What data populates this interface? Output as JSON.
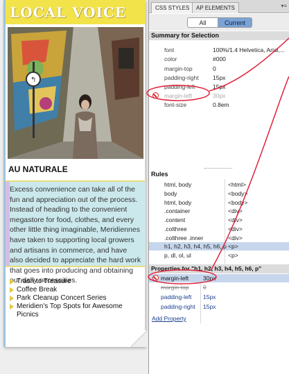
{
  "page_mockup": {
    "logo": "LOCAL VOICE",
    "headline": "AU NATURALE",
    "description": "Excess convenience can take all of the fun and appreciation out of the process. Instead of heading to the convenient megastore for food, clothes, and every other little thing imaginable, Meridiennes have taken to supporting local growers and artisans in commerce, and have also decided to appreciate the hard work that goes into producing and obtaining our daily necessities.",
    "links": [
      "Trash to Treasure",
      "Coffee Break",
      "Park Cleanup Concert Series",
      "Meridien's Top Spots for Awesome Picnics"
    ]
  },
  "panel": {
    "tabs": [
      "CSS STYLES",
      "AP ELEMENTS"
    ],
    "modes": {
      "all": "All",
      "current": "Current"
    },
    "summary_title": "Summary for Selection",
    "summary_rows": [
      {
        "key": "font",
        "value": "100%/1.4 Helvetica, Arial,...",
        "disabled": false
      },
      {
        "key": "color",
        "value": "#000",
        "disabled": false
      },
      {
        "key": "margin-top",
        "value": "0",
        "disabled": false
      },
      {
        "key": "padding-right",
        "value": "15px",
        "disabled": false
      },
      {
        "key": "padding-left",
        "value": "15px",
        "disabled": false
      },
      {
        "key": "margin-left",
        "value": "30px",
        "disabled": true
      },
      {
        "key": "font-size",
        "value": "0.8em",
        "disabled": false
      }
    ],
    "rules_title": "Rules",
    "rules": [
      {
        "selector": "html, body",
        "tag": "<html>",
        "selected": false
      },
      {
        "selector": "body",
        "tag": "<body>",
        "selected": false
      },
      {
        "selector": "html, body",
        "tag": "<body>",
        "selected": false
      },
      {
        "selector": ".container",
        "tag": "<div>",
        "selected": false
      },
      {
        "selector": ".content",
        "tag": "<div>",
        "selected": false
      },
      {
        "selector": ".colthree",
        "tag": "<div>",
        "selected": false
      },
      {
        "selector": ".colthree .inner",
        "tag": "<div>",
        "selected": false
      },
      {
        "selector": "h1, h2, h3, h4, h5, h6, p",
        "tag": "<p>",
        "selected": true
      },
      {
        "selector": "p, dl, ol, ul",
        "tag": "<p>",
        "selected": false
      }
    ],
    "properties_title": "Properties for \"h1, h2, h3, h4, h5, h6, p\"",
    "properties": [
      {
        "key": "margin-left",
        "value": "30px",
        "selected": true,
        "struck": false,
        "warning": true
      },
      {
        "key": "margin-top",
        "value": "0",
        "selected": false,
        "struck": true,
        "warning": false
      },
      {
        "key": "padding-left",
        "value": "15px",
        "selected": false,
        "struck": false,
        "warning": false
      },
      {
        "key": "padding-right",
        "value": "15px",
        "selected": false,
        "struck": false,
        "warning": false
      }
    ],
    "add_property": "Add Property"
  },
  "colors": {
    "masthead": "#f3e34a",
    "highlight_box": "#cbe8ec",
    "selection": "#c6d6ec",
    "annotation": "#e0203a"
  }
}
